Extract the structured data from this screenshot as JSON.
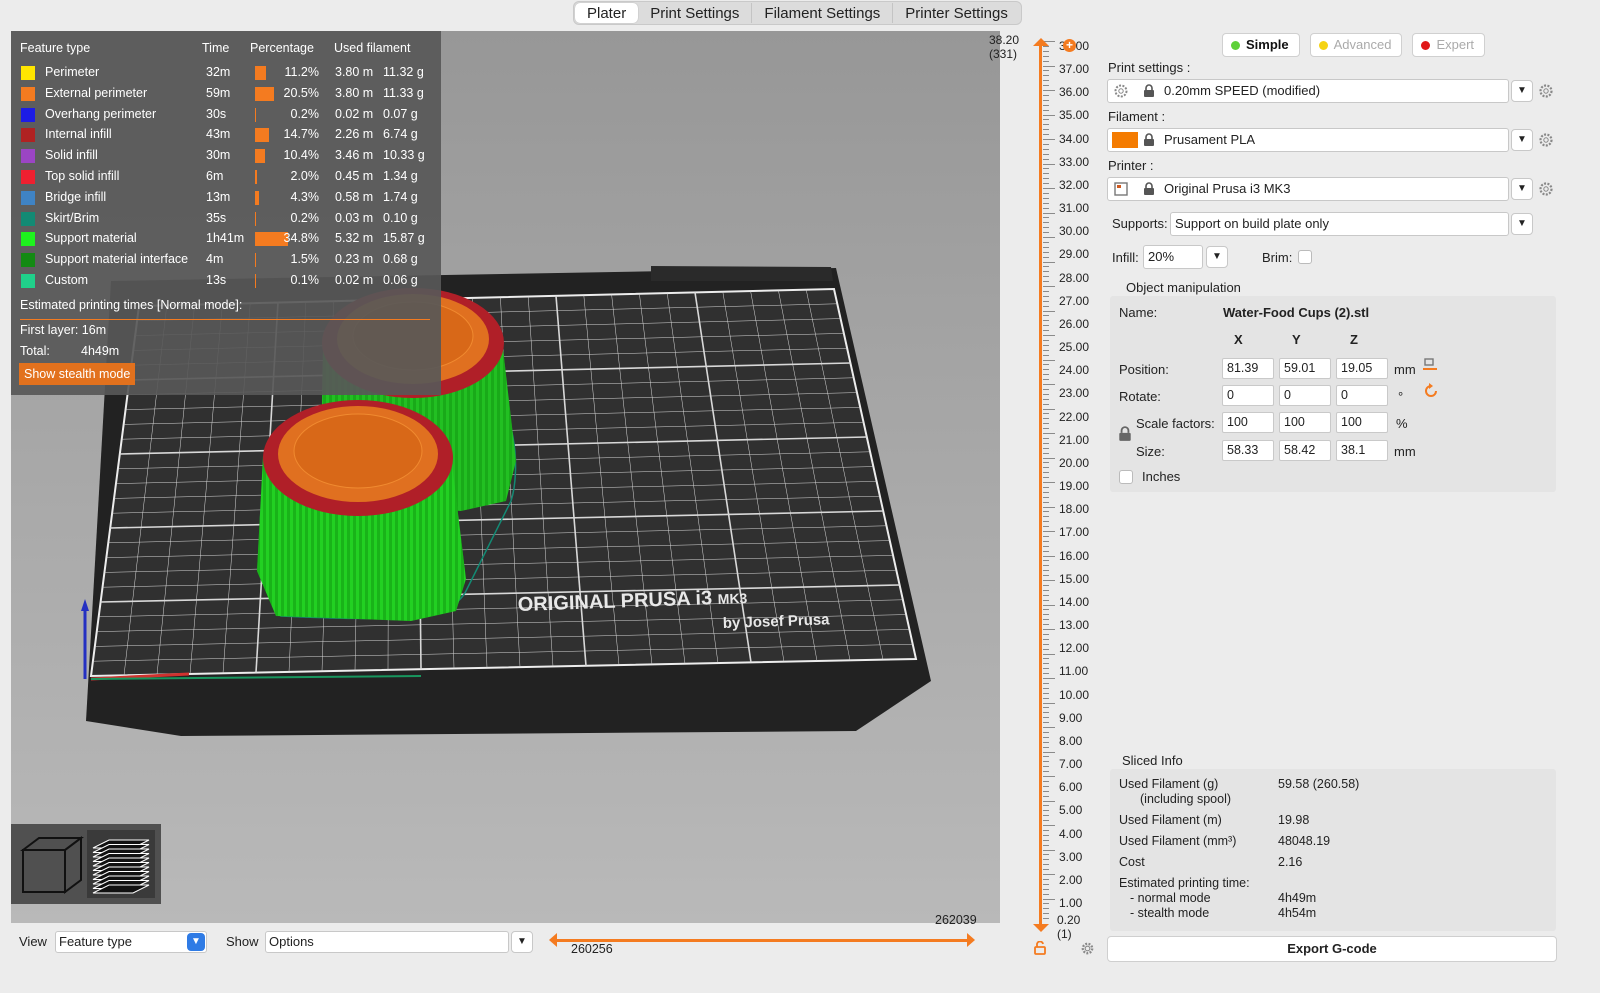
{
  "tabs": [
    {
      "label": "Plater"
    },
    {
      "label": "Print Settings"
    },
    {
      "label": "Filament Settings"
    },
    {
      "label": "Printer Settings"
    }
  ],
  "legend": {
    "headers": {
      "feature": "Feature type",
      "time": "Time",
      "percentage": "Percentage",
      "filament": "Used filament"
    },
    "rows": [
      {
        "name": "Perimeter",
        "color": "#ffe600",
        "time": "32m",
        "percent": "11.2%",
        "meters": "3.80 m",
        "grams": "11.32 g",
        "fraction": 0.112
      },
      {
        "name": "External perimeter",
        "color": "#f47b20",
        "time": "59m",
        "percent": "20.5%",
        "meters": "3.80 m",
        "grams": "11.33 g",
        "fraction": 0.205
      },
      {
        "name": "Overhang perimeter",
        "color": "#1c1ce6",
        "time": "30s",
        "percent": "0.2%",
        "meters": "0.02 m",
        "grams": "0.07 g",
        "fraction": 0.002
      },
      {
        "name": "Internal infill",
        "color": "#b02222",
        "time": "43m",
        "percent": "14.7%",
        "meters": "2.26 m",
        "grams": "6.74 g",
        "fraction": 0.147
      },
      {
        "name": "Solid infill",
        "color": "#9b45c4",
        "time": "30m",
        "percent": "10.4%",
        "meters": "3.46 m",
        "grams": "10.33 g",
        "fraction": 0.104
      },
      {
        "name": "Top solid infill",
        "color": "#ee2030",
        "time": "6m",
        "percent": "2.0%",
        "meters": "0.45 m",
        "grams": "1.34 g",
        "fraction": 0.02
      },
      {
        "name": "Bridge infill",
        "color": "#3f83c4",
        "time": "13m",
        "percent": "4.3%",
        "meters": "0.58 m",
        "grams": "1.74 g",
        "fraction": 0.043
      },
      {
        "name": "Skirt/Brim",
        "color": "#138a74",
        "time": "35s",
        "percent": "0.2%",
        "meters": "0.03 m",
        "grams": "0.10 g",
        "fraction": 0.002
      },
      {
        "name": "Support material",
        "color": "#1ef21e",
        "time": "1h41m",
        "percent": "34.8%",
        "meters": "5.32 m",
        "grams": "15.87 g",
        "fraction": 0.348
      },
      {
        "name": "Support material interface",
        "color": "#138a13",
        "time": "4m",
        "percent": "1.5%",
        "meters": "0.23 m",
        "grams": "0.68 g",
        "fraction": 0.015
      },
      {
        "name": "Custom",
        "color": "#20d08a",
        "time": "13s",
        "percent": "0.1%",
        "meters": "0.02 m",
        "grams": "0.06 g",
        "fraction": 0.001
      }
    ],
    "estimated_title": "Estimated printing times [Normal mode]:",
    "first_layer": "First layer: 16m",
    "total_label": "Total:",
    "total_value": "4h49m",
    "stealth_button": "Show stealth mode"
  },
  "bed": {
    "brand_line1": "ORIGINAL PRUSA i3",
    "brand_model": "MK3",
    "brand_line2": "by Josef Prusa"
  },
  "layer_slider": {
    "top_value": "38.20",
    "top_layer": "(331)",
    "bottom_value": "0.20",
    "bottom_layer": "(1)",
    "tick_labels": [
      "38.00",
      "37.00",
      "36.00",
      "35.00",
      "34.00",
      "33.00",
      "32.00",
      "31.00",
      "30.00",
      "29.00",
      "28.00",
      "27.00",
      "26.00",
      "25.00",
      "24.00",
      "23.00",
      "22.00",
      "21.00",
      "20.00",
      "19.00",
      "18.00",
      "17.00",
      "16.00",
      "15.00",
      "14.00",
      "13.00",
      "12.00",
      "11.00",
      "10.00",
      "9.00",
      "8.00",
      "7.00",
      "6.00",
      "5.00",
      "4.00",
      "3.00",
      "2.00",
      "1.00"
    ],
    "plus_label": "+"
  },
  "bottom_bar": {
    "view_label": "View",
    "view_value": "Feature type",
    "show_label": "Show",
    "show_value": "Options",
    "move_left_value": "260256",
    "move_right_value": "262039"
  },
  "sidebar": {
    "modes": [
      {
        "label": "Simple",
        "color": "#5fd13a",
        "selected": true
      },
      {
        "label": "Advanced",
        "color": "#f5d314",
        "selected": false
      },
      {
        "label": "Expert",
        "color": "#e01919",
        "selected": false
      }
    ],
    "print_settings_label": "Print settings :",
    "print_settings_value": "0.20mm SPEED (modified)",
    "filament_label": "Filament :",
    "filament_value": "Prusament PLA",
    "filament_color": "#f47b00",
    "printer_label": "Printer :",
    "printer_value": "Original Prusa i3 MK3",
    "supports_label": "Supports:",
    "supports_value": "Support on build plate only",
    "infill_label": "Infill:",
    "infill_value": "20%",
    "brim_label": "Brim:",
    "object_manipulation": {
      "title": "Object manipulation",
      "name_label": "Name:",
      "name_value": "Water-Food Cups (2).stl",
      "axes": [
        "X",
        "Y",
        "Z"
      ],
      "position_label": "Position:",
      "position": [
        "81.39",
        "59.01",
        "19.05"
      ],
      "position_unit": "mm",
      "rotate_label": "Rotate:",
      "rotate": [
        "0",
        "0",
        "0"
      ],
      "rotate_unit": "°",
      "scale_label": "Scale factors:",
      "scale": [
        "100",
        "100",
        "100"
      ],
      "scale_unit": "%",
      "size_label": "Size:",
      "size": [
        "58.33",
        "58.42",
        "38.1"
      ],
      "size_unit": "mm",
      "inches_label": "Inches"
    },
    "sliced_info": {
      "title": "Sliced Info",
      "used_g_label": "Used Filament (g)",
      "used_g_sub": "(including spool)",
      "used_g_value": "59.58 (260.58)",
      "used_m_label": "Used Filament (m)",
      "used_m_value": "19.98",
      "used_mm3_label": "Used Filament (mm³)",
      "used_mm3_value": "48048.19",
      "cost_label": "Cost",
      "cost_value": "2.16",
      "est_label": "Estimated printing time:",
      "normal_label": "- normal mode",
      "normal_value": "4h49m",
      "stealth_label": "- stealth mode",
      "stealth_value": "4h54m"
    },
    "export_button": "Export G-code"
  }
}
